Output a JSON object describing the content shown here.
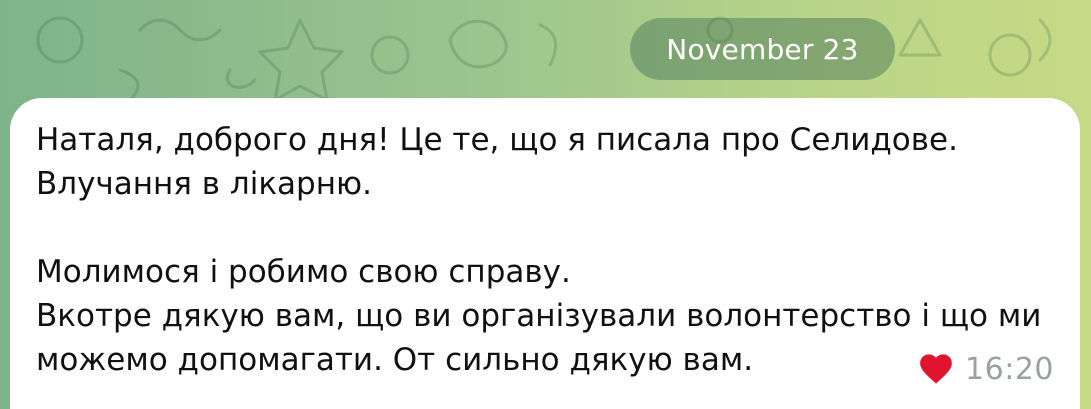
{
  "date_separator": "November 23",
  "message": {
    "lines": [
      "Наталя, доброго дня! Це те, що я писала про Селидове.",
      "Влучання в лікарню.",
      "",
      "Молимося і робимо свою справу.",
      "Вкотре дякую вам, що ви організували волонтерство і що ми",
      "можемо допомагати. От сильно дякую вам."
    ],
    "time": "16:20",
    "reaction_icon": "heart-icon"
  },
  "colors": {
    "bubble": "#ffffff",
    "heart": "#e0142e",
    "time": "#9aa0a6"
  }
}
